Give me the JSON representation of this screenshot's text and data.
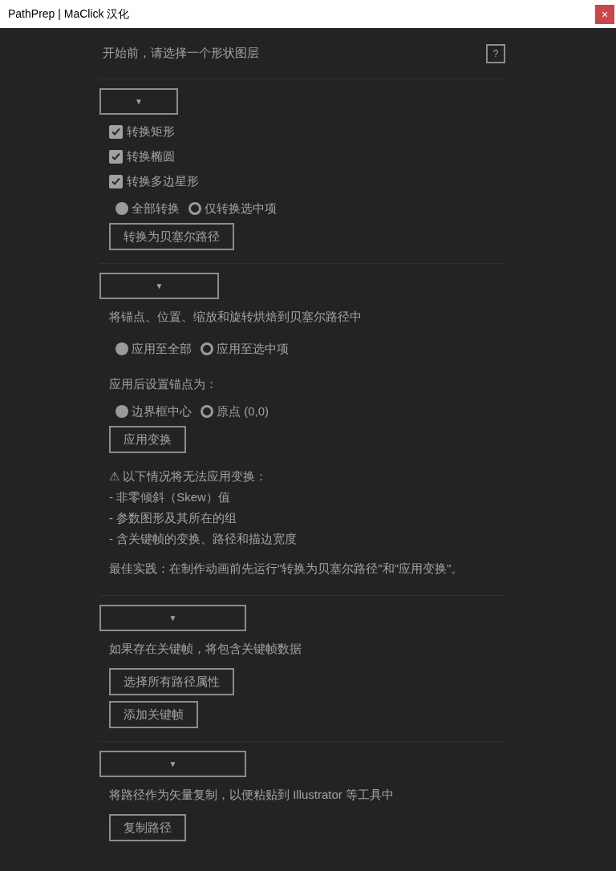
{
  "window": {
    "title": "PathPrep | MaClick 汉化",
    "close": "×"
  },
  "header": {
    "text": "开始前，请选择一个形状图层",
    "help": "?"
  },
  "sections": [
    {
      "dropdown": "▼",
      "items": [
        {
          "kind": "checkbox",
          "label": "转换矩形",
          "checked": true
        },
        {
          "kind": "checkbox",
          "label": "转换椭圆",
          "checked": true
        },
        {
          "kind": "checkbox",
          "label": "转换多边星形",
          "checked": true
        },
        {
          "kind": "radios",
          "options": [
            {
              "label": "全部转换",
              "selected": true
            },
            {
              "label": "仅转换选中项",
              "selected": false
            }
          ]
        },
        {
          "kind": "button",
          "label": "转换为贝塞尔路径"
        }
      ]
    },
    {
      "dropdown": "▼",
      "items": [
        {
          "kind": "text",
          "text": "将锚点、位置、缩放和旋转烘焙到贝塞尔路径中"
        },
        {
          "kind": "radios",
          "options": [
            {
              "label": "应用至全部",
              "selected": true
            },
            {
              "label": "应用至选中项",
              "selected": false
            }
          ]
        },
        {
          "kind": "label",
          "text": "应用后设置锚点为："
        },
        {
          "kind": "radios",
          "options": [
            {
              "label": "边界框中心",
              "selected": true
            },
            {
              "label": "原点 (0,0)",
              "selected": false
            }
          ]
        },
        {
          "kind": "button",
          "label": "应用变换"
        },
        {
          "kind": "notes",
          "lines": [
            "⚠ 以下情况将无法应用变换：",
            "- 非零倾斜（Skew）值",
            "- 参数图形及其所在的组",
            "- 含关键帧的变换、路径和描边宽度"
          ]
        },
        {
          "kind": "text",
          "text": "最佳实践：在制作动画前先运行\"转换为贝塞尔路径\"和\"应用变换\"。"
        }
      ]
    },
    {
      "dropdown": "▼",
      "items": [
        {
          "kind": "text",
          "text": "如果存在关键帧，将包含关键帧数据"
        },
        {
          "kind": "button",
          "label": "选择所有路径属性"
        },
        {
          "kind": "button",
          "label": "添加关键帧"
        }
      ]
    },
    {
      "dropdown": "▼",
      "items": [
        {
          "kind": "text",
          "text": "将路径作为矢量复制，以便粘贴到 Illustrator 等工具中"
        },
        {
          "kind": "button",
          "label": "复制路径"
        }
      ]
    }
  ]
}
